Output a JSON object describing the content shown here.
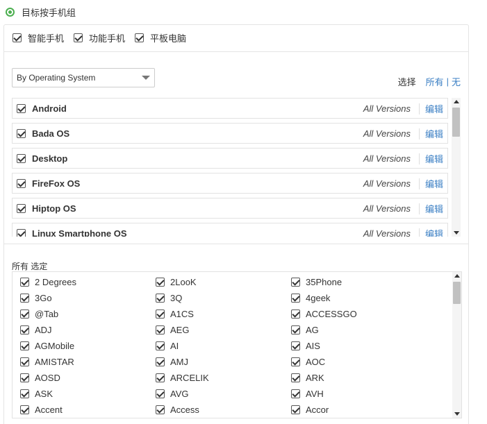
{
  "header": {
    "title": "目标按手机组"
  },
  "device_types": [
    "智能手机",
    "功能手机",
    "平板电脑"
  ],
  "filter": {
    "selected": "By Operating System"
  },
  "choose": {
    "label": "选择",
    "all": "所有",
    "sep": "|",
    "none": "无"
  },
  "os_list": [
    {
      "name": "Android",
      "versions": "All Versions",
      "edit": "编辑"
    },
    {
      "name": "Bada OS",
      "versions": "All Versions",
      "edit": "编辑"
    },
    {
      "name": "Desktop",
      "versions": "All Versions",
      "edit": "编辑"
    },
    {
      "name": "FireFox OS",
      "versions": "All Versions",
      "edit": "编辑"
    },
    {
      "name": "Hiptop OS",
      "versions": "All Versions",
      "edit": "编辑"
    },
    {
      "name": "Linux Smartphone OS",
      "versions": "All Versions",
      "edit": "编辑"
    }
  ],
  "brands_section": {
    "title": "所有 选定"
  },
  "brands": [
    "2 Degrees",
    "2LooK",
    "35Phone",
    "3Go",
    "3Q",
    "4geek",
    "@Tab",
    "A1CS",
    "ACCESSGO",
    "ADJ",
    "AEG",
    "AG",
    "AGMobile",
    "AI",
    "AIS",
    "AMISTAR",
    "AMJ",
    "AOC",
    "AOSD",
    "ARCELIK",
    "ARK",
    "ASK",
    "AVG",
    "AVH",
    "Accent",
    "Access",
    "Accor"
  ]
}
